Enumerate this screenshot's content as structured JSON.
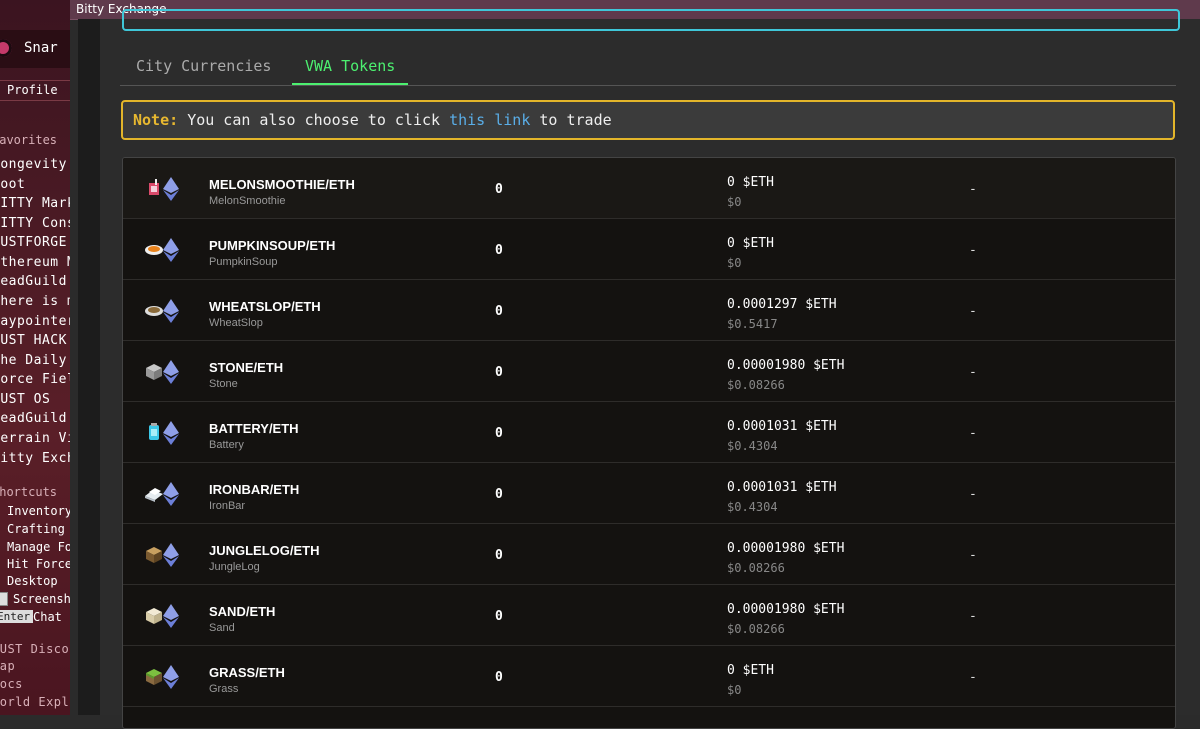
{
  "window": {
    "title": "Bitty Exchange"
  },
  "sidebar": {
    "username": "Snar",
    "profile_label": "Profile",
    "favorites_title": "Favorites",
    "favorites": [
      "Longevity",
      "Loot",
      "BITTY Market",
      "BITTY Constr",
      "DUSTFORGE",
      "Ethereum Mo",
      "DeadGuild Fo",
      "Where is my",
      "Waypointer",
      "DUST HACK #",
      "The Daily Du",
      "Force Fields",
      "DUST OS",
      "DeadGuild RA",
      "Terrain View",
      "Bitty Exchan"
    ],
    "shortcuts_title": "Shortcuts",
    "shortcuts": [
      "Inventory",
      "Crafting",
      "Manage Fo",
      "Hit Force",
      "Desktop",
      "Screensh",
      "Chat"
    ],
    "enter_key": "Enter",
    "links": [
      "DUST Discord D",
      "Map",
      "Docs",
      "World Explorer"
    ]
  },
  "tabs": [
    {
      "label": "City Currencies",
      "active": false
    },
    {
      "label": "VWA Tokens",
      "active": true
    }
  ],
  "note": {
    "label": "Note:",
    "text_before": "You can also choose to click",
    "link_text": "this link",
    "text_after": "to trade"
  },
  "tokens": [
    {
      "pair": "MELONSMOOTHIE/ETH",
      "name": "MelonSmoothie",
      "amount": "0",
      "price": "0 $ETH",
      "usd": "$0",
      "change": "-",
      "icon": "melon-smoothie-icon"
    },
    {
      "pair": "PUMPKINSOUP/ETH",
      "name": "PumpkinSoup",
      "amount": "0",
      "price": "0 $ETH",
      "usd": "$0",
      "change": "-",
      "icon": "pumpkin-soup-icon"
    },
    {
      "pair": "WHEATSLOP/ETH",
      "name": "WheatSlop",
      "amount": "0",
      "price": "0.0001297 $ETH",
      "usd": "$0.5417",
      "change": "-",
      "icon": "wheat-slop-icon"
    },
    {
      "pair": "STONE/ETH",
      "name": "Stone",
      "amount": "0",
      "price": "0.00001980 $ETH",
      "usd": "$0.08266",
      "change": "-",
      "icon": "stone-block-icon"
    },
    {
      "pair": "BATTERY/ETH",
      "name": "Battery",
      "amount": "0",
      "price": "0.0001031 $ETH",
      "usd": "$0.4304",
      "change": "-",
      "icon": "battery-icon"
    },
    {
      "pair": "IRONBAR/ETH",
      "name": "IronBar",
      "amount": "0",
      "price": "0.0001031 $ETH",
      "usd": "$0.4304",
      "change": "-",
      "icon": "iron-bar-icon"
    },
    {
      "pair": "JUNGLELOG/ETH",
      "name": "JungleLog",
      "amount": "0",
      "price": "0.00001980 $ETH",
      "usd": "$0.08266",
      "change": "-",
      "icon": "jungle-log-icon"
    },
    {
      "pair": "SAND/ETH",
      "name": "Sand",
      "amount": "0",
      "price": "0.00001980 $ETH",
      "usd": "$0.08266",
      "change": "-",
      "icon": "sand-block-icon"
    },
    {
      "pair": "GRASS/ETH",
      "name": "Grass",
      "amount": "0",
      "price": "0 $ETH",
      "usd": "$0",
      "change": "-",
      "icon": "grass-block-icon"
    }
  ],
  "colors": {
    "accent_green": "#4cf070",
    "note_border": "#e3b52a",
    "link_blue": "#5aaee8",
    "top_border": "#3fc7d8"
  }
}
